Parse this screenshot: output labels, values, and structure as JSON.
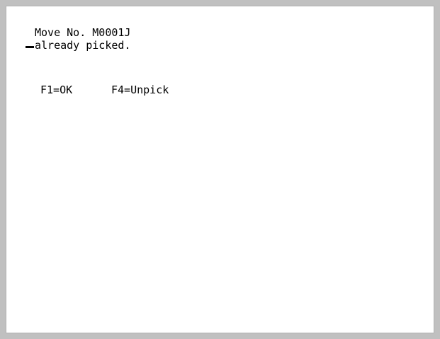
{
  "screen": {
    "message": {
      "line1": "Move No. M0001J",
      "line2": "already picked."
    },
    "function_keys": {
      "f1": "F1=OK",
      "f4": "F4=Unpick"
    }
  }
}
